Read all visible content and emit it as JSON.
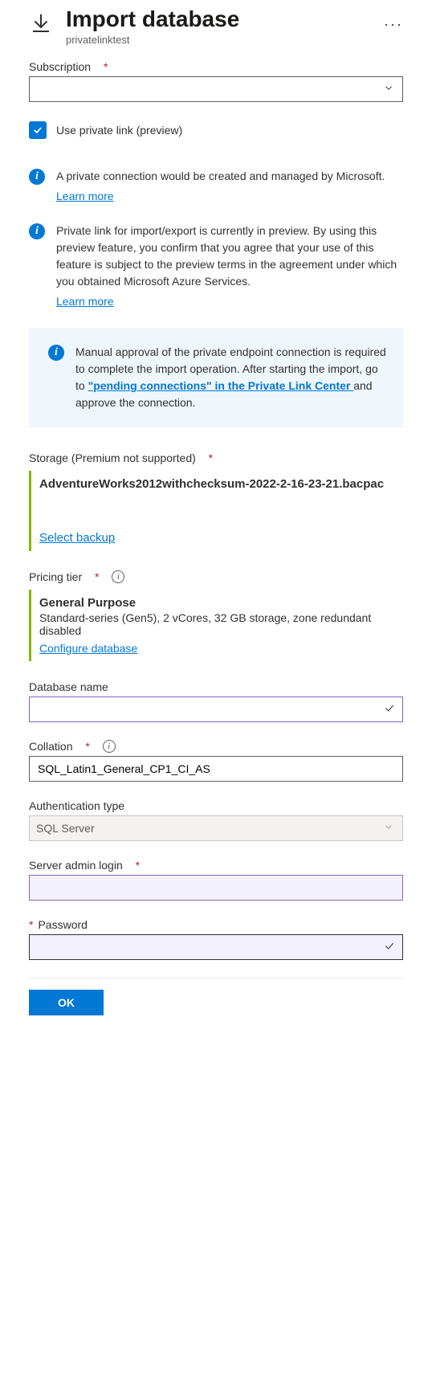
{
  "header": {
    "title": "Import database",
    "subtitle": "privatelinktest"
  },
  "subscription": {
    "label": "Subscription",
    "value": ""
  },
  "private_link_checkbox": {
    "label": "Use private link (preview)",
    "checked": true
  },
  "info1": {
    "text": "A private connection would be created and managed by Microsoft.",
    "link": "Learn more"
  },
  "info2": {
    "text": "Private link for import/export is currently in preview. By using this preview feature, you confirm that you agree that your use of this feature is subject to the preview terms in the agreement under which you obtained Microsoft Azure Services.",
    "link": "Learn more"
  },
  "callout": {
    "pre": "Manual approval of the private endpoint connection is required to complete the import operation. After starting the import, go to ",
    "link": "\"pending connections\" in the Private Link Center ",
    "post": "and approve the connection."
  },
  "storage": {
    "label": "Storage (Premium not supported)",
    "file": "AdventureWorks2012withchecksum-2022-2-16-23-21.bacpac",
    "action": "Select backup"
  },
  "pricing": {
    "label": "Pricing tier",
    "tier_name": "General Purpose",
    "tier_desc": "Standard-series (Gen5), 2 vCores, 32 GB storage, zone redundant disabled",
    "action": "Configure database"
  },
  "db_name": {
    "label": "Database name",
    "value": ""
  },
  "collation": {
    "label": "Collation",
    "value": "SQL_Latin1_General_CP1_CI_AS"
  },
  "auth_type": {
    "label": "Authentication type",
    "value": "SQL Server"
  },
  "admin_login": {
    "label": "Server admin login",
    "value": ""
  },
  "password": {
    "label": "Password",
    "value": ""
  },
  "footer": {
    "ok": "OK"
  }
}
